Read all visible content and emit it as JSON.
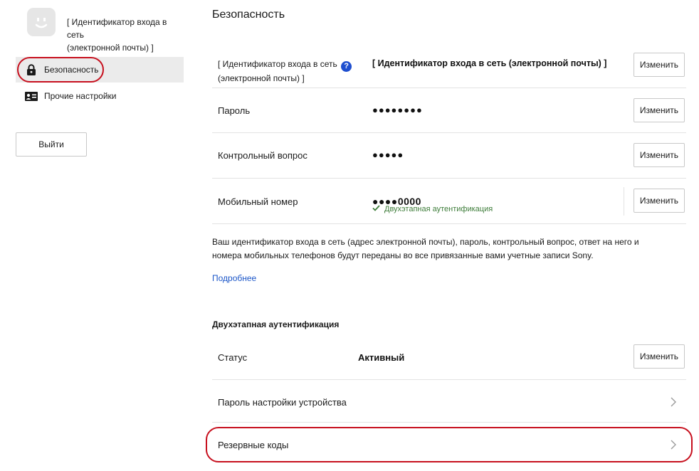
{
  "sidebar": {
    "user_id_line1": "[ Идентификатор входа в сеть",
    "user_id_line2": "(электронной почты) ]",
    "nav": [
      {
        "label": "Безопасность",
        "icon": "lock-icon",
        "active": true
      },
      {
        "label": "Прочие настройки",
        "icon": "id-card-icon",
        "active": false
      }
    ],
    "logout_label": "Выйти"
  },
  "main": {
    "title": "Безопасность",
    "rows": [
      {
        "label_line1": "[ Идентификатор входа в сеть",
        "label_line2": "(электронной почты) ]",
        "help_icon": "question-circle-icon",
        "value": "[ Идентификатор входа в сеть (электронной почты) ]",
        "button": "Изменить"
      },
      {
        "label": "Пароль",
        "value": "●●●●●●●●",
        "button": "Изменить"
      },
      {
        "label": "Контрольный вопрос",
        "value": "●●●●●",
        "button": "Изменить"
      },
      {
        "label": "Мобильный номер",
        "value": "●●●●0000",
        "sub_status": "Двухэтапная аутентификация",
        "sub_status_icon": "check-icon",
        "button": "Изменить"
      }
    ],
    "notice_line1": "Ваш идентификатор входа в сеть (адрес электронной почты), пароль, контрольный вопрос, ответ на него и",
    "notice_line2": "номера мобильных телефонов будут переданы во все привязанные вами учетные записи Sony.",
    "more_link": "Подробнее",
    "two_step": {
      "title": "Двухэтапная аутентификация",
      "status_label": "Статус",
      "status_value": "Активный",
      "status_button": "Изменить",
      "device_password_label": "Пароль настройки устройства",
      "backup_codes_label": "Резервные коды"
    }
  },
  "colors": {
    "highlight": "#c7101e",
    "link": "#1a55c8",
    "success": "#3e7d3a",
    "help": "#1f4fcf"
  }
}
